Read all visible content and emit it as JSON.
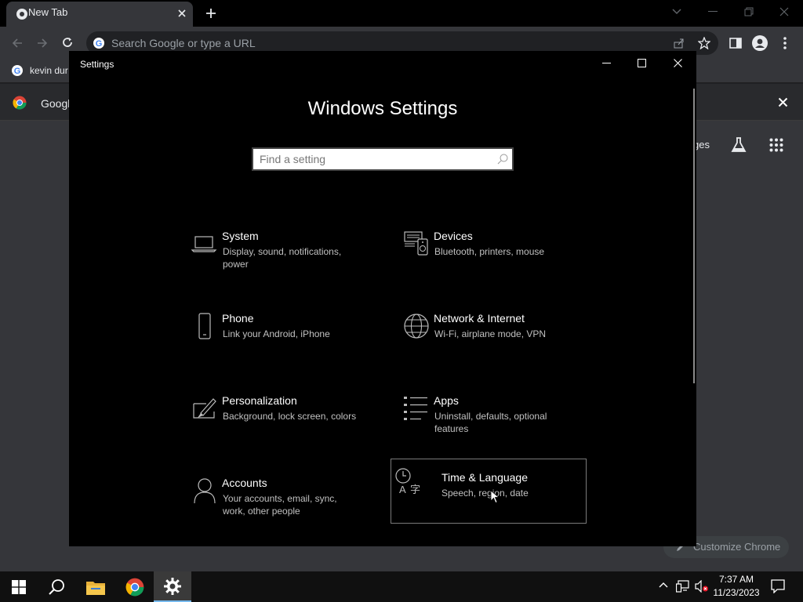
{
  "browser": {
    "tab_title": "New Tab",
    "omnibox_placeholder": "Search Google or type a URL",
    "bookmark_label": "kevin dur",
    "infobar_label": "Googl",
    "images_label": "ges",
    "customize_label": "Customize Chrome"
  },
  "settings_window": {
    "title": "Settings",
    "heading": "Windows Settings",
    "search_placeholder": "Find a setting",
    "tiles": [
      {
        "title": "System",
        "desc": "Display, sound, notifications, power",
        "icon": "laptop-icon"
      },
      {
        "title": "Devices",
        "desc": "Bluetooth, printers, mouse",
        "icon": "devices-icon"
      },
      {
        "title": "Phone",
        "desc": "Link your Android, iPhone",
        "icon": "phone-icon"
      },
      {
        "title": "Network & Internet",
        "desc": "Wi-Fi, airplane mode, VPN",
        "icon": "globe-icon"
      },
      {
        "title": "Personalization",
        "desc": "Background, lock screen, colors",
        "icon": "paintbrush-icon"
      },
      {
        "title": "Apps",
        "desc": "Uninstall, defaults, optional features",
        "icon": "apps-list-icon"
      },
      {
        "title": "Accounts",
        "desc": "Your accounts, email, sync, work, other people",
        "icon": "person-icon"
      },
      {
        "title": "Time & Language",
        "desc": "Speech, region, date",
        "icon": "time-language-icon"
      }
    ]
  },
  "taskbar": {
    "time": "7:37 AM",
    "date": "11/23/2023"
  },
  "colors": {
    "settings_bg": "#000000",
    "chrome_bg": "#35363a",
    "taskbar_bg": "#101010"
  }
}
